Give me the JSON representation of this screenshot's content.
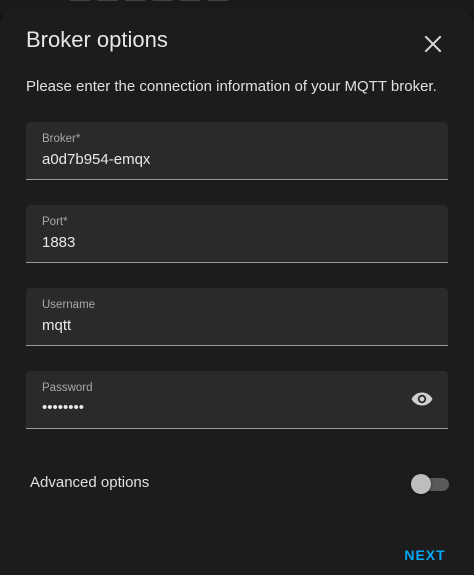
{
  "dialog": {
    "title": "Broker options",
    "description": "Please enter the connection information of your MQTT broker."
  },
  "fields": {
    "broker": {
      "label": "Broker*",
      "value": "a0d7b954-emqx"
    },
    "port": {
      "label": "Port*",
      "value": "1883"
    },
    "username": {
      "label": "Username",
      "value": "mqtt"
    },
    "password": {
      "label": "Password",
      "value": "••••••••"
    }
  },
  "advanced": {
    "label": "Advanced options",
    "enabled": false
  },
  "actions": {
    "next_label": "NEXT"
  },
  "icons": {
    "close": "close-icon",
    "visibility": "eye-icon"
  },
  "colors": {
    "accent": "#03a9f4",
    "dialog_bg": "#1c1c1c",
    "field_bg": "#2a2a2a",
    "text_primary": "#e6e6e6",
    "text_secondary": "#a9a9a9"
  }
}
